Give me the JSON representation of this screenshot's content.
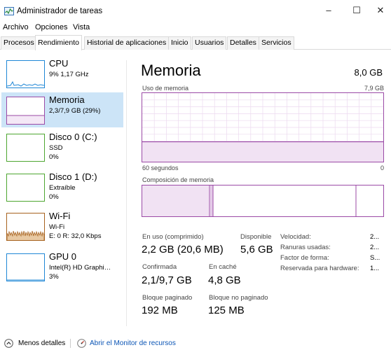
{
  "window": {
    "title": "Administrador de tareas"
  },
  "window_controls": {
    "minimize": "–",
    "maximize": "☐",
    "close": "✕"
  },
  "menu": [
    "Archivo",
    "Opciones",
    "Vista"
  ],
  "tabs": [
    "Procesos",
    "Rendimiento",
    "Historial de aplicaciones",
    "Inicio",
    "Usuarios",
    "Detalles",
    "Servicios"
  ],
  "active_tab": "Rendimiento",
  "sidebar": [
    {
      "title": "CPU",
      "lines": [
        "9%  1,17 GHz"
      ],
      "color": "#1f87d6"
    },
    {
      "title": "Memoria",
      "lines": [
        "2,3/7,9 GB (29%)"
      ],
      "color": "#9b4aa6"
    },
    {
      "title": "Disco 0 (C:)",
      "lines": [
        "SSD",
        "0%"
      ],
      "color": "#4da630"
    },
    {
      "title": "Disco 1 (D:)",
      "lines": [
        "Extraíble",
        "0%"
      ],
      "color": "#4da630"
    },
    {
      "title": "Wi-Fi",
      "lines": [
        "Wi-Fi",
        "E: 0  R: 32,0 Kbps"
      ],
      "color": "#a7621e"
    },
    {
      "title": "GPU 0",
      "lines": [
        "Intel(R) HD Graphi…",
        "3%"
      ],
      "color": "#1f87d6"
    }
  ],
  "main": {
    "title": "Memoria",
    "total": "8,0 GB",
    "usage_label": "Uso de memoria",
    "usage_max": "7,9 GB",
    "time_label": "60 segundos",
    "time_zero": "0",
    "composition_label": "Composición de memoria",
    "usage_fraction": 0.29,
    "stats": {
      "in_use_label": "En uso (comprimido)",
      "in_use": "2,2 GB (20,6 MB)",
      "available_label": "Disponible",
      "available": "5,6 GB",
      "committed_label": "Confirmada",
      "committed": "2,1/9,7 GB",
      "cached_label": "En caché",
      "cached": "4,8 GB",
      "paged_label": "Bloque paginado",
      "paged": "192 MB",
      "nonpaged_label": "Bloque no paginado",
      "nonpaged": "125 MB"
    },
    "props": [
      {
        "label": "Velocidad:",
        "value": "2..."
      },
      {
        "label": "Ranuras usadas:",
        "value": "2..."
      },
      {
        "label": "Factor de forma:",
        "value": "S..."
      },
      {
        "label": "Reservada para hardware:",
        "value": "1..."
      }
    ]
  },
  "footer": {
    "less_details": "Menos detalles",
    "resource_monitor": "Abrir el Monitor de recursos"
  }
}
